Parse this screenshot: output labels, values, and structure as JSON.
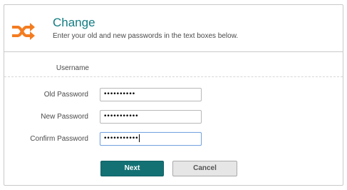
{
  "header": {
    "title": "Change",
    "subtitle": "Enter your old and new passwords in the text boxes below.",
    "logo_icon": "shuffle-icon",
    "accent_color": "#127c82",
    "logo_color": "#f47c20"
  },
  "username": {
    "label": "Username"
  },
  "fields": {
    "old_password": {
      "label": "Old Password",
      "value": "••••••••••"
    },
    "new_password": {
      "label": "New Password",
      "value": "•••••••••••"
    },
    "confirm_password": {
      "label": "Confirm Password",
      "value": "•••••••••••"
    }
  },
  "buttons": {
    "next_label": "Next",
    "cancel_label": "Cancel"
  }
}
